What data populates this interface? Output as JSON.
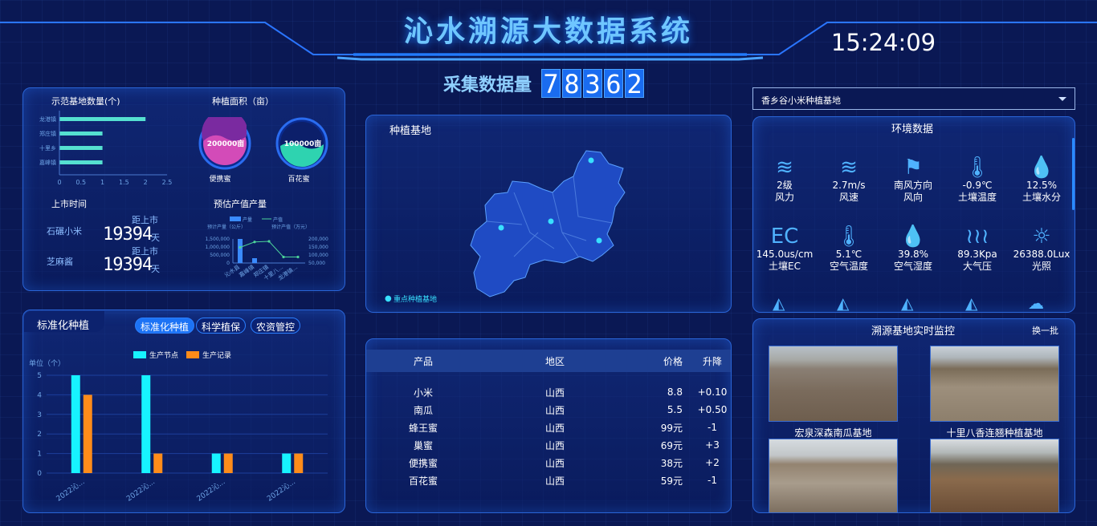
{
  "header": {
    "title": "沁水溯源大数据系统",
    "clock": "15:24:09"
  },
  "counter": {
    "label": "采集数据量",
    "digits": [
      "7",
      "8",
      "3",
      "6",
      "2"
    ]
  },
  "site_select": {
    "value": "香乡谷小米种植基地"
  },
  "base_count": {
    "title": "示范基地数量(个)",
    "chart_data": {
      "type": "bar",
      "orientation": "horizontal",
      "categories": [
        "龙港镇",
        "郑庄镇",
        "十里乡",
        "嘉峰镇"
      ],
      "values": [
        2,
        1,
        1,
        1
      ],
      "xlim": [
        0,
        2.5
      ],
      "ticks": [
        "0",
        "0.5",
        "1",
        "1.5",
        "2",
        "2.5"
      ]
    }
  },
  "area": {
    "title": "种植面积（亩）",
    "items": [
      {
        "value": "200000亩",
        "label": "便携蜜"
      },
      {
        "value": "100000亩",
        "label": "百花蜜"
      }
    ]
  },
  "listing": {
    "title": "上市时间",
    "items": [
      {
        "name": "石碾小米",
        "prefix": "距上市",
        "days": "19394",
        "unit": "天"
      },
      {
        "name": "芝麻酱",
        "prefix": "距上市",
        "days": "19394",
        "unit": "天"
      }
    ]
  },
  "forecast": {
    "title": "预估产值产量",
    "chart_data": {
      "type": "bar+line",
      "legend": [
        "产量",
        "产值"
      ],
      "left_label": "预计产量（公斤）",
      "right_label": "预计产值（万元）",
      "left_ticks": [
        "1,500,000",
        "1,000,000",
        "500,000",
        "0"
      ],
      "right_ticks": [
        "200,000",
        "150,000",
        "100,000",
        "50,000"
      ],
      "categories": [
        "沁水县",
        "嘉峰镇",
        "郑庄镇",
        "十里八...",
        "龙港镇..."
      ],
      "bars": [
        1500000,
        300000,
        0,
        0,
        0
      ],
      "line": [
        130000,
        175000,
        180000,
        50000,
        50000
      ]
    }
  },
  "standard": {
    "title": "标准化种植",
    "tabs": [
      "标准化种植",
      "科学植保",
      "农资管控"
    ],
    "chart_data": {
      "type": "bar",
      "unit_label": "单位（个）",
      "series": [
        {
          "name": "生产节点",
          "values": [
            5,
            5,
            1,
            1
          ]
        },
        {
          "name": "生产记录",
          "values": [
            4,
            1,
            1,
            1
          ]
        }
      ],
      "categories": [
        "2022沁...",
        "2022沁...",
        "2022沁...",
        "2022沁..."
      ],
      "ylim": [
        0,
        5
      ],
      "yticks": [
        "0",
        "1",
        "2",
        "3",
        "4",
        "5"
      ]
    }
  },
  "map": {
    "title": "种植基地",
    "legend": "重点种植基地"
  },
  "price_table": {
    "headers": [
      "产品",
      "地区",
      "价格",
      "升降"
    ],
    "rows": [
      [
        "小米",
        "山西",
        "8.8",
        "+0.10"
      ],
      [
        "南瓜",
        "山西",
        "5.5",
        "+0.50"
      ],
      [
        "蜂王蜜",
        "山西",
        "99元",
        "-1"
      ],
      [
        "巢蜜",
        "山西",
        "69元",
        "+3"
      ],
      [
        "便携蜜",
        "山西",
        "38元",
        "+2"
      ],
      [
        "百花蜜",
        "山西",
        "59元",
        "-1"
      ]
    ]
  },
  "env": {
    "title": "环境数据",
    "items": [
      {
        "icon": "wind-icon",
        "value": "2级",
        "label": "风力"
      },
      {
        "icon": "wind-speed-icon",
        "value": "2.7m/s",
        "label": "风速"
      },
      {
        "icon": "wind-direction-icon",
        "value": "南风方向",
        "label": "风向"
      },
      {
        "icon": "soil-temperature-icon",
        "value": "-0.9℃",
        "label": "土壤温度"
      },
      {
        "icon": "soil-moisture-icon",
        "value": "12.5%",
        "label": "土壤水分"
      },
      {
        "icon": "ec-icon",
        "value": "145.0us/cm",
        "label": "土壤EC"
      },
      {
        "icon": "thermometer-icon",
        "value": "5.1℃",
        "label": "空气温度"
      },
      {
        "icon": "humidity-icon",
        "value": "39.8%",
        "label": "空气湿度"
      },
      {
        "icon": "pressure-icon",
        "value": "89.3Kpa",
        "label": "大气压"
      },
      {
        "icon": "sun-icon",
        "value": "26388.0Lux",
        "label": "光照"
      }
    ]
  },
  "monitor": {
    "title": "溯源基地实时监控",
    "refresh": "换一批",
    "captions": [
      "宏泉深森南瓜基地",
      "十里八香连翘种植基地"
    ]
  }
}
